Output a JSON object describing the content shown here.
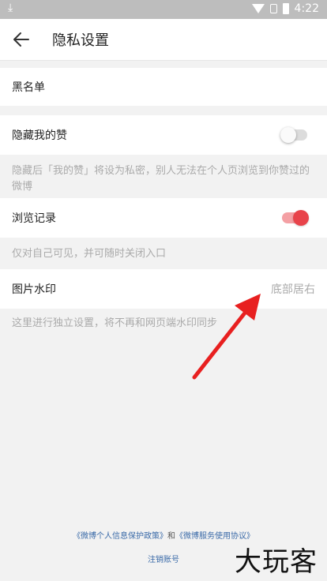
{
  "status_bar": {
    "time": "4:22"
  },
  "header": {
    "title": "隐私设置"
  },
  "blacklist": {
    "label": "黑名单"
  },
  "hide_likes": {
    "label": "隐藏我的赞",
    "enabled": false,
    "description": "隐藏后「我的赞」将设为私密，别人无法在个人页浏览到你赞过的微博"
  },
  "browse_history": {
    "label": "浏览记录",
    "enabled": true,
    "description": "仅对自己可见，并可随时关闭入口"
  },
  "watermark": {
    "label": "图片水印",
    "value": "底部居右",
    "description": "这里进行独立设置，将不再和网页端水印同步"
  },
  "footer": {
    "privacy_link": "《微博个人信息保护政策》",
    "and_text": "和",
    "service_link": "《微博服务使用协议》",
    "cancel_account": "注销账号"
  },
  "watermark_logo": "大玩客",
  "colors": {
    "accent": "#e8434a",
    "toggle_on_track": "#f4a0a4",
    "toggle_off_track": "#dcdcdc",
    "link": "#3a6aa8",
    "annotation_arrow": "#e82020"
  }
}
